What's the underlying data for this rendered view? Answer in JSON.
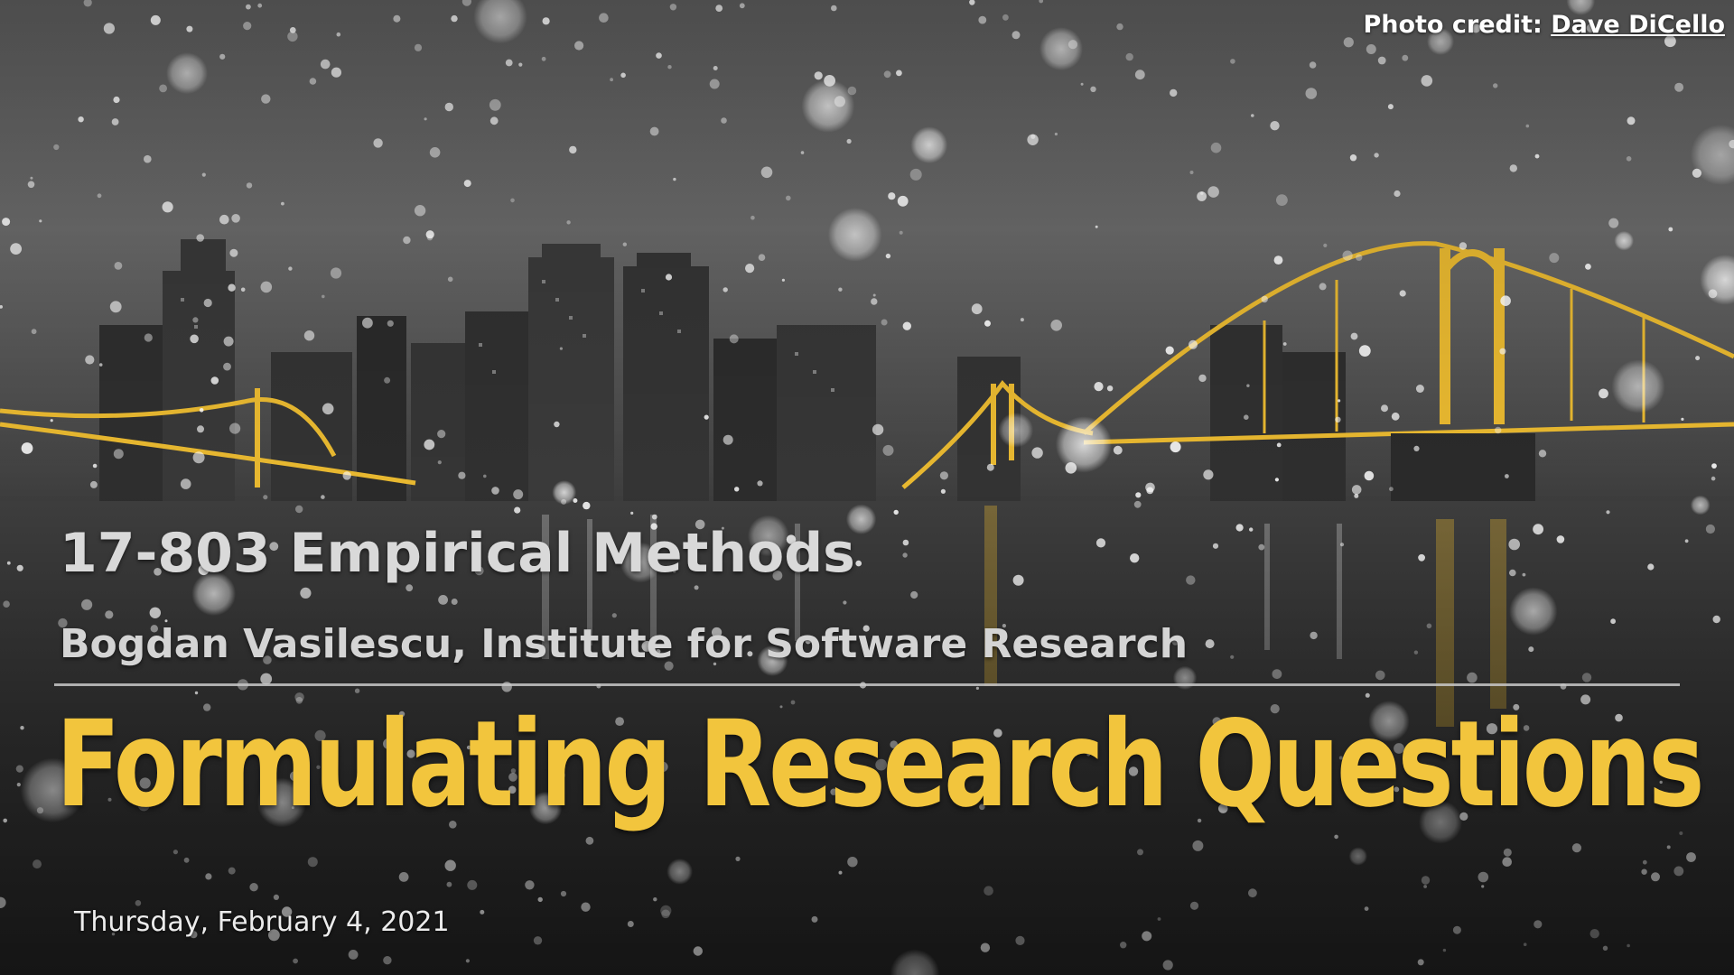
{
  "slide": {
    "photo_credit_prefix": "Photo credit: ",
    "photo_credit_name": "Dave DiCello",
    "course": "17-803 Empirical Methods",
    "author": "Bogdan Vasilescu, Institute for Software Research",
    "title": "Formulating Research Questions",
    "date": "Thursday, February 4, 2021"
  },
  "colors": {
    "title": "#f2c53d",
    "bridge": "#e8b830",
    "subtitle": "#d9d9d9",
    "background": "#3a3a3a"
  }
}
